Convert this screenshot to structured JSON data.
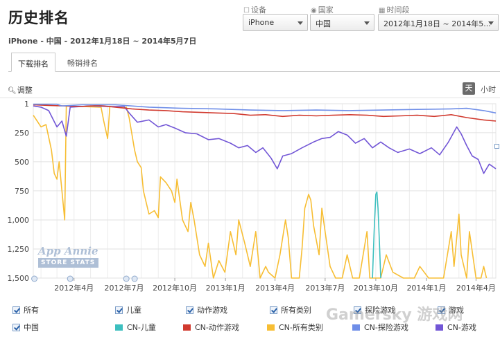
{
  "header": {
    "title": "历史排名",
    "subtitle": "iPhone - 中国 - 2012年1月18日 ~ 2014年5月7日"
  },
  "filters": {
    "device": {
      "label": "设备",
      "icon": "device-icon",
      "value": "iPhone"
    },
    "country": {
      "label": "国家",
      "icon": "globe-icon",
      "value": "中国"
    },
    "period": {
      "label": "时间段",
      "icon": "calendar-icon",
      "value": "2012年1月18日 ~ 2014年5..."
    }
  },
  "tabs": [
    {
      "label": "下载排名",
      "active": true
    },
    {
      "label": "畅销排名",
      "active": false
    }
  ],
  "toolbar": {
    "adjust_label": "调整",
    "day_label": "天",
    "hour_label": "小时"
  },
  "logo": {
    "line1": "App Annie",
    "line2": "STORE STATS"
  },
  "watermark": "Gamersky 游戏网",
  "filters_row": [
    {
      "label": "所有"
    },
    {
      "label": "儿童"
    },
    {
      "label": "动作游戏"
    },
    {
      "label": "所有类别"
    },
    {
      "label": "探险游戏"
    },
    {
      "label": "游戏"
    }
  ],
  "chart_data": {
    "type": "line",
    "ylim": [
      1,
      1500
    ],
    "y_reversed": true,
    "y_ticks": [
      1,
      250,
      500,
      750,
      1000,
      1250,
      1500
    ],
    "y_tick_labels": [
      "1",
      "250",
      "500",
      "750",
      "1,000",
      "1,250",
      "1,500"
    ],
    "x_range": [
      "2012-01-18",
      "2014-05-07"
    ],
    "x_ticks": [
      "2012年4月",
      "2012年7月",
      "2012年10月",
      "2013年1月",
      "2013年4月",
      "2013年7月",
      "2013年10月",
      "2014年1月",
      "2014年4月"
    ],
    "grid": true,
    "legend_placement": "bottom",
    "legend_group": "中国",
    "series": [
      {
        "name": "CN-儿童",
        "color": "#3dbfbf",
        "points": [
          [
            "2013-09-25",
            1500
          ],
          [
            "2013-09-28",
            1100
          ],
          [
            "2013-10-01",
            780
          ],
          [
            "2013-10-03",
            760
          ],
          [
            "2013-10-05",
            900
          ],
          [
            "2013-10-08",
            1250
          ],
          [
            "2013-10-10",
            1500
          ]
        ]
      },
      {
        "name": "CN-动作游戏",
        "color": "#d13a2f",
        "points": [
          [
            "2012-01-18",
            10
          ],
          [
            "2012-02-15",
            15
          ],
          [
            "2012-03-15",
            20
          ],
          [
            "2012-04-15",
            25
          ],
          [
            "2012-05-15",
            15
          ],
          [
            "2012-06-15",
            30
          ],
          [
            "2012-07-15",
            45
          ],
          [
            "2012-08-15",
            55
          ],
          [
            "2012-09-15",
            60
          ],
          [
            "2012-10-15",
            70
          ],
          [
            "2012-11-15",
            75
          ],
          [
            "2012-12-15",
            80
          ],
          [
            "2013-01-15",
            85
          ],
          [
            "2013-02-15",
            100
          ],
          [
            "2013-03-15",
            95
          ],
          [
            "2013-04-15",
            110
          ],
          [
            "2013-05-15",
            100
          ],
          [
            "2013-06-15",
            105
          ],
          [
            "2013-07-15",
            100
          ],
          [
            "2013-08-15",
            95
          ],
          [
            "2013-09-15",
            100
          ],
          [
            "2013-10-15",
            110
          ],
          [
            "2013-11-15",
            105
          ],
          [
            "2013-12-15",
            100
          ],
          [
            "2014-01-15",
            110
          ],
          [
            "2014-02-15",
            95
          ],
          [
            "2014-03-15",
            120
          ],
          [
            "2014-04-15",
            140
          ],
          [
            "2014-05-07",
            150
          ]
        ]
      },
      {
        "name": "CN-所有类别",
        "color": "#f7be34",
        "points": [
          [
            "2012-01-18",
            100
          ],
          [
            "2012-01-25",
            150
          ],
          [
            "2012-02-01",
            200
          ],
          [
            "2012-02-10",
            180
          ],
          [
            "2012-02-20",
            400
          ],
          [
            "2012-02-25",
            600
          ],
          [
            "2012-03-01",
            650
          ],
          [
            "2012-03-05",
            500
          ],
          [
            "2012-03-10",
            750
          ],
          [
            "2012-03-15",
            1000
          ],
          [
            "2012-03-18",
            20
          ],
          [
            "2012-04-15",
            25
          ],
          [
            "2012-05-20",
            30
          ],
          [
            "2012-05-25",
            150
          ],
          [
            "2012-06-01",
            300
          ],
          [
            "2012-06-05",
            25
          ],
          [
            "2012-06-20",
            30
          ],
          [
            "2012-07-01",
            35
          ],
          [
            "2012-07-05",
            30
          ],
          [
            "2012-07-10",
            120
          ],
          [
            "2012-07-20",
            400
          ],
          [
            "2012-07-25",
            500
          ],
          [
            "2012-08-01",
            550
          ],
          [
            "2012-08-05",
            750
          ],
          [
            "2012-08-15",
            950
          ],
          [
            "2012-08-25",
            920
          ],
          [
            "2012-09-01",
            980
          ],
          [
            "2012-09-05",
            630
          ],
          [
            "2012-09-15",
            680
          ],
          [
            "2012-09-25",
            750
          ],
          [
            "2012-10-01",
            850
          ],
          [
            "2012-10-05",
            650
          ],
          [
            "2012-10-15",
            1000
          ],
          [
            "2012-10-25",
            1100
          ],
          [
            "2012-10-30",
            850
          ],
          [
            "2012-11-05",
            1000
          ],
          [
            "2012-11-15",
            1300
          ],
          [
            "2012-11-25",
            1400
          ],
          [
            "2012-12-01",
            1200
          ],
          [
            "2012-12-10",
            1500
          ],
          [
            "2012-12-20",
            1350
          ],
          [
            "2012-12-31",
            1450
          ],
          [
            "2013-01-10",
            1100
          ],
          [
            "2013-01-20",
            1300
          ],
          [
            "2013-01-25",
            1000
          ],
          [
            "2013-02-05",
            1200
          ],
          [
            "2013-02-15",
            1400
          ],
          [
            "2013-02-25",
            1100
          ],
          [
            "2013-03-05",
            1500
          ],
          [
            "2013-03-15",
            1400
          ],
          [
            "2013-03-20",
            1450
          ],
          [
            "2013-04-01",
            1500
          ],
          [
            "2013-04-10",
            1300
          ],
          [
            "2013-04-20",
            1000
          ],
          [
            "2013-04-25",
            1150
          ],
          [
            "2013-05-01",
            1500
          ],
          [
            "2013-05-15",
            1500
          ],
          [
            "2013-05-20",
            1250
          ],
          [
            "2013-05-25",
            900
          ],
          [
            "2013-06-01",
            780
          ],
          [
            "2013-06-05",
            830
          ],
          [
            "2013-06-10",
            1050
          ],
          [
            "2013-06-20",
            1300
          ],
          [
            "2013-06-25",
            900
          ],
          [
            "2013-07-01",
            1100
          ],
          [
            "2013-07-10",
            1400
          ],
          [
            "2013-07-20",
            1500
          ],
          [
            "2013-08-01",
            1500
          ],
          [
            "2013-08-10",
            1300
          ],
          [
            "2013-08-20",
            1500
          ],
          [
            "2013-09-01",
            1500
          ],
          [
            "2013-09-15",
            1100
          ],
          [
            "2013-09-20",
            1500
          ],
          [
            "2013-10-10",
            1500
          ],
          [
            "2013-10-20",
            1300
          ],
          [
            "2013-11-01",
            1450
          ],
          [
            "2013-11-20",
            1500
          ],
          [
            "2013-12-10",
            1500
          ],
          [
            "2013-12-20",
            1400
          ],
          [
            "2014-01-05",
            1500
          ],
          [
            "2014-02-01",
            1500
          ],
          [
            "2014-02-15",
            1100
          ],
          [
            "2014-02-20",
            1400
          ],
          [
            "2014-03-01",
            950
          ],
          [
            "2014-03-05",
            1300
          ],
          [
            "2014-03-15",
            1500
          ],
          [
            "2014-03-20",
            1100
          ],
          [
            "2014-04-01",
            1500
          ],
          [
            "2014-04-10",
            1500
          ],
          [
            "2014-04-15",
            1400
          ],
          [
            "2014-04-20",
            1500
          ]
        ]
      },
      {
        "name": "CN-探险游戏",
        "color": "#6f8ee8",
        "points": [
          [
            "2012-01-18",
            5
          ],
          [
            "2012-03-01",
            5
          ],
          [
            "2012-03-10",
            20
          ],
          [
            "2012-04-15",
            10
          ],
          [
            "2012-06-15",
            10
          ],
          [
            "2012-08-15",
            30
          ],
          [
            "2012-10-15",
            40
          ],
          [
            "2012-12-15",
            45
          ],
          [
            "2013-02-15",
            55
          ],
          [
            "2013-04-15",
            60
          ],
          [
            "2013-06-15",
            55
          ],
          [
            "2013-08-15",
            60
          ],
          [
            "2013-10-15",
            55
          ],
          [
            "2013-12-15",
            50
          ],
          [
            "2014-02-15",
            45
          ],
          [
            "2014-03-15",
            40
          ],
          [
            "2014-04-15",
            60
          ],
          [
            "2014-05-07",
            80
          ]
        ]
      },
      {
        "name": "CN-游戏",
        "color": "#7256d6",
        "points": [
          [
            "2012-01-18",
            20
          ],
          [
            "2012-02-01",
            30
          ],
          [
            "2012-02-15",
            60
          ],
          [
            "2012-03-01",
            200
          ],
          [
            "2012-03-10",
            150
          ],
          [
            "2012-03-18",
            280
          ],
          [
            "2012-03-25",
            30
          ],
          [
            "2012-05-01",
            20
          ],
          [
            "2012-06-01",
            25
          ],
          [
            "2012-07-01",
            25
          ],
          [
            "2012-07-10",
            80
          ],
          [
            "2012-07-25",
            160
          ],
          [
            "2012-08-15",
            140
          ],
          [
            "2012-09-01",
            200
          ],
          [
            "2012-09-15",
            180
          ],
          [
            "2012-10-01",
            210
          ],
          [
            "2012-10-20",
            250
          ],
          [
            "2012-11-10",
            260
          ],
          [
            "2012-12-01",
            310
          ],
          [
            "2012-12-20",
            300
          ],
          [
            "2013-01-10",
            340
          ],
          [
            "2013-01-25",
            380
          ],
          [
            "2013-02-10",
            360
          ],
          [
            "2013-02-25",
            420
          ],
          [
            "2013-03-10",
            380
          ],
          [
            "2013-03-25",
            470
          ],
          [
            "2013-04-05",
            560
          ],
          [
            "2013-04-15",
            450
          ],
          [
            "2013-05-01",
            430
          ],
          [
            "2013-05-20",
            380
          ],
          [
            "2013-06-10",
            330
          ],
          [
            "2013-06-25",
            300
          ],
          [
            "2013-07-10",
            290
          ],
          [
            "2013-07-25",
            240
          ],
          [
            "2013-08-10",
            270
          ],
          [
            "2013-08-25",
            340
          ],
          [
            "2013-09-10",
            300
          ],
          [
            "2013-09-25",
            380
          ],
          [
            "2013-10-10",
            330
          ],
          [
            "2013-10-25",
            380
          ],
          [
            "2013-11-10",
            420
          ],
          [
            "2013-12-01",
            390
          ],
          [
            "2013-12-20",
            430
          ],
          [
            "2014-01-10",
            380
          ],
          [
            "2014-01-25",
            440
          ],
          [
            "2014-02-10",
            330
          ],
          [
            "2014-02-25",
            200
          ],
          [
            "2014-03-05",
            260
          ],
          [
            "2014-03-15",
            360
          ],
          [
            "2014-03-25",
            450
          ],
          [
            "2014-04-05",
            480
          ],
          [
            "2014-04-15",
            600
          ],
          [
            "2014-04-25",
            520
          ],
          [
            "2014-05-07",
            560
          ]
        ]
      }
    ]
  }
}
